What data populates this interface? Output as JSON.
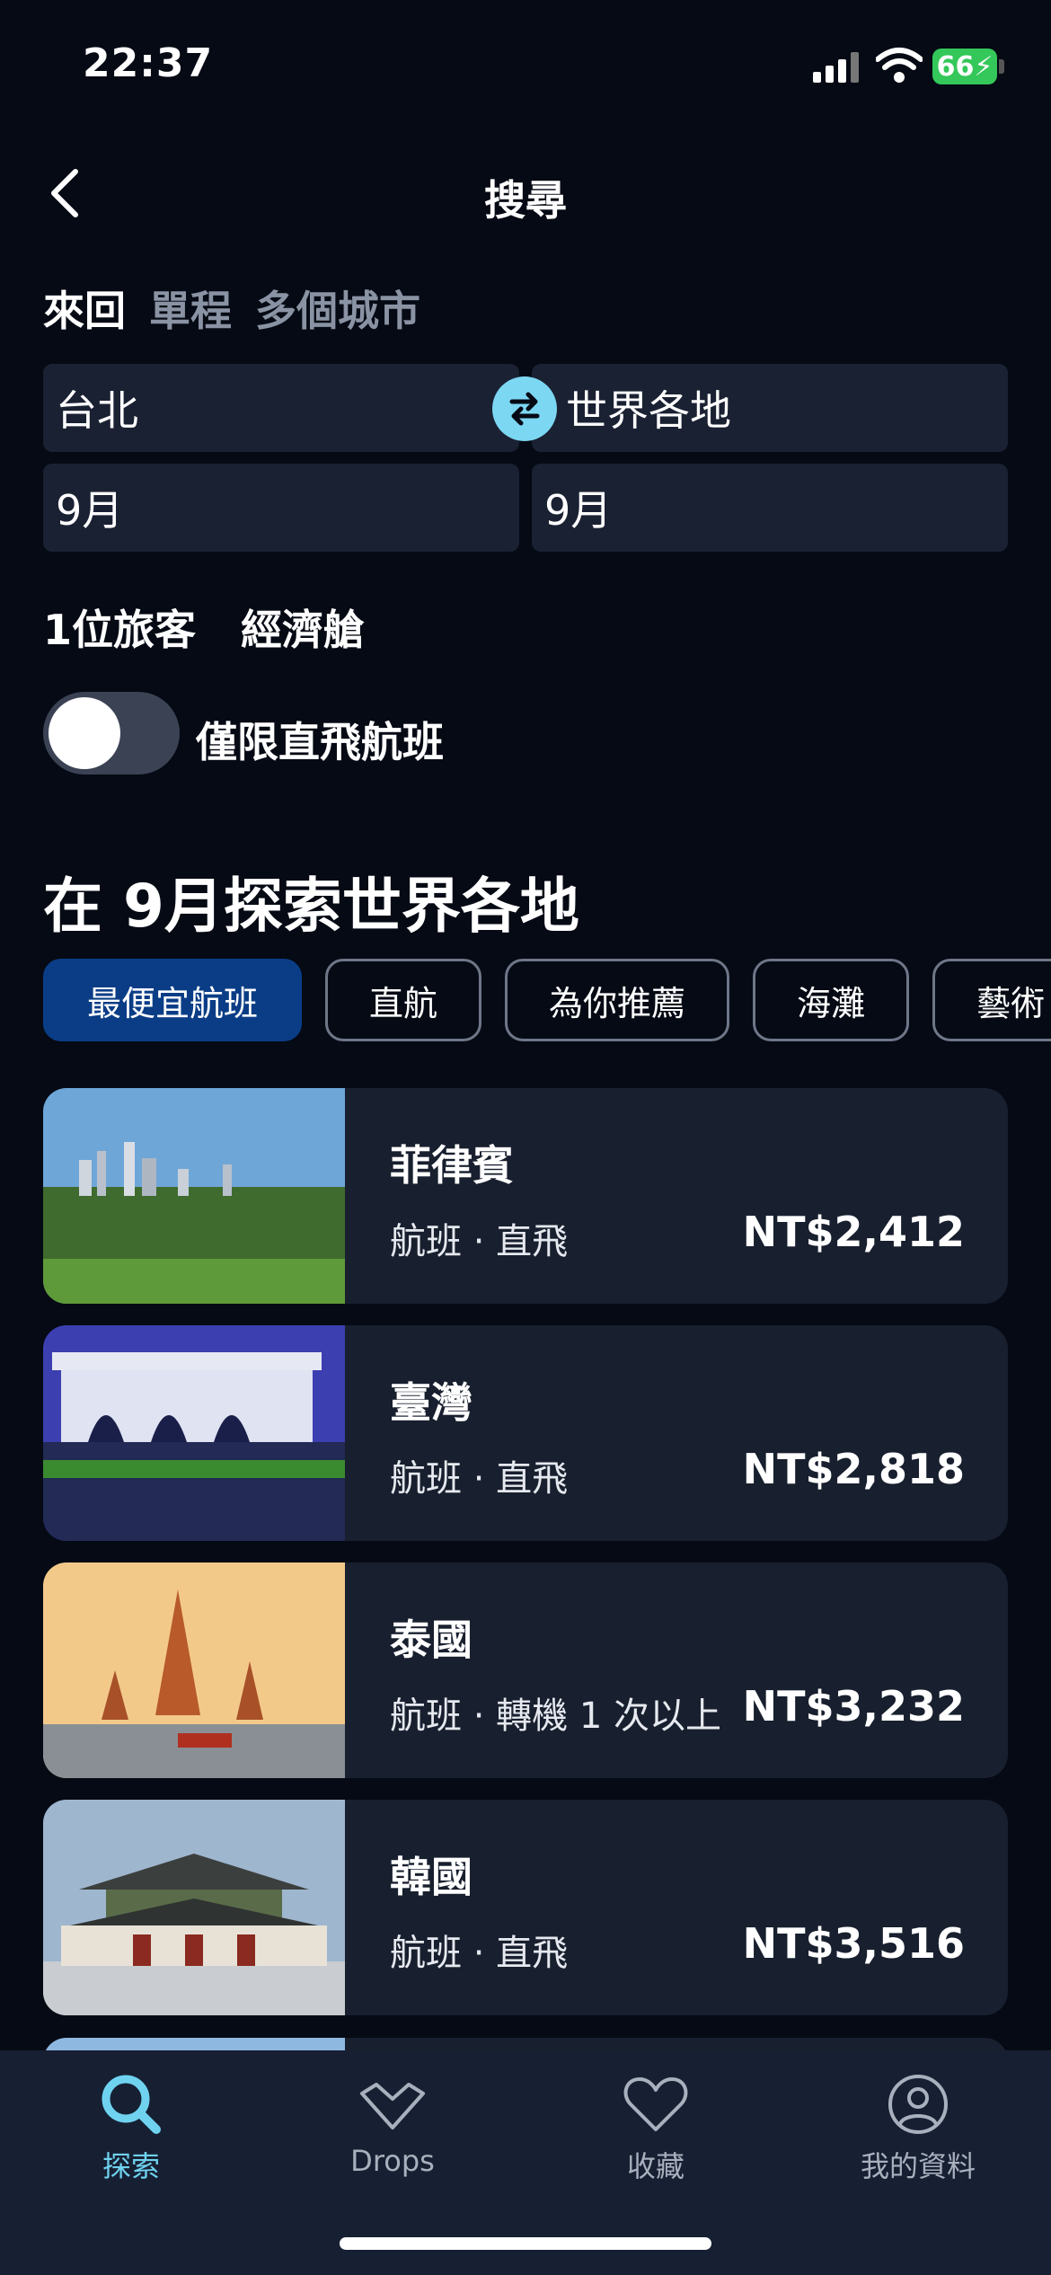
{
  "status": {
    "time": "22:37",
    "battery": "66"
  },
  "header": {
    "title": "搜尋",
    "back_icon": "chevron-left-icon"
  },
  "trip_types": [
    {
      "label": "來回",
      "active": true
    },
    {
      "label": "單程",
      "active": false
    },
    {
      "label": "多個城市",
      "active": false
    }
  ],
  "search": {
    "origin": "台北",
    "destination": "世界各地",
    "depart": "9月",
    "return": "9月",
    "swap_icon": "swap-arrows-icon"
  },
  "travelers": {
    "count": "1位旅客",
    "cabin": "經濟艙"
  },
  "direct_toggle": {
    "label": "僅限直飛航班",
    "on": false
  },
  "section_title": "在 9月探索世界各地",
  "filters": [
    {
      "label": "最便宜航班",
      "active": true
    },
    {
      "label": "直航",
      "active": false
    },
    {
      "label": "為你推薦",
      "active": false
    },
    {
      "label": "海灘",
      "active": false
    },
    {
      "label": "藝術",
      "active": false
    }
  ],
  "destinations": [
    {
      "name": "菲律賓",
      "detail": "航班 · 直飛",
      "price": "NT$2,412"
    },
    {
      "name": "臺灣",
      "detail": "航班 · 直飛",
      "price": "NT$2,818"
    },
    {
      "name": "泰國",
      "detail": "航班 · 轉機 1 次以上",
      "price": "NT$3,232"
    },
    {
      "name": "韓國",
      "detail": "航班 · 直飛",
      "price": "NT$3,516"
    }
  ],
  "tabbar": [
    {
      "label": "探索",
      "icon": "search-icon",
      "active": true
    },
    {
      "label": "Drops",
      "icon": "heart-drop-icon",
      "active": false
    },
    {
      "label": "收藏",
      "icon": "heart-icon",
      "active": false
    },
    {
      "label": "我的資料",
      "icon": "profile-icon",
      "active": false
    }
  ],
  "colors": {
    "background": "#050a14",
    "card": "#181f2e",
    "accent": "#6fd3f0",
    "chip_active": "#0a3d86"
  }
}
